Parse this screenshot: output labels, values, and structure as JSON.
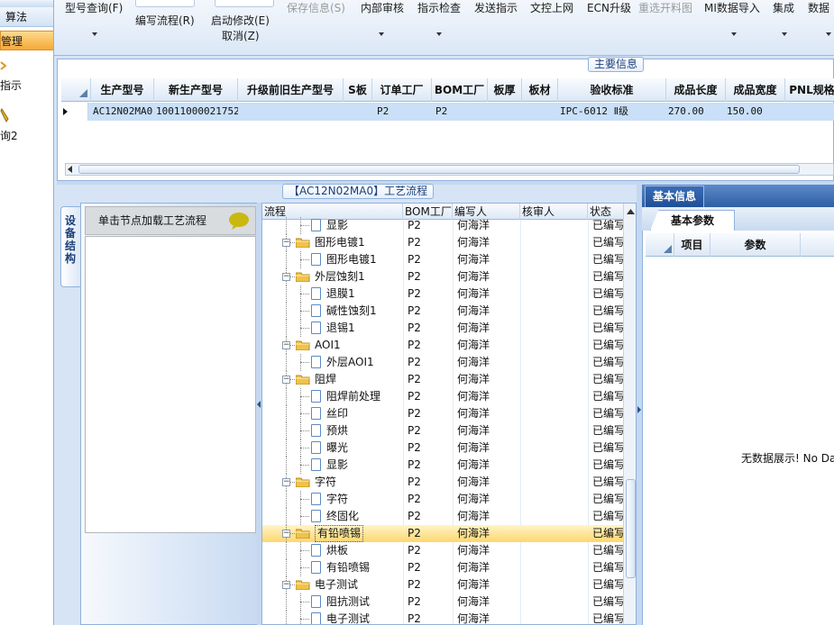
{
  "leftnav": {
    "items": [
      "算法",
      "管理",
      "指示",
      "询2"
    ]
  },
  "toolbar": {
    "items": [
      {
        "label": "型号查询(F)",
        "enabled": true
      },
      {
        "label": "编写流程(R)",
        "enabled": true
      },
      {
        "label": "启动修改(E)",
        "enabled": true
      },
      {
        "label": "取消(Z)",
        "enabled": true
      },
      {
        "label": "保存信息(S)",
        "enabled": false
      },
      {
        "label": "内部审核",
        "enabled": true
      },
      {
        "label": "指示检查",
        "enabled": true
      },
      {
        "label": "发送指示",
        "enabled": true
      },
      {
        "label": "文控上网",
        "enabled": true
      },
      {
        "label": "ECN升级",
        "enabled": true
      },
      {
        "label": "重选开料图",
        "enabled": false
      },
      {
        "label": "MI数据导入",
        "enabled": true
      },
      {
        "label": "集成",
        "enabled": true
      },
      {
        "label": "数据",
        "enabled": true
      }
    ]
  },
  "main_panel": {
    "caption": "主要信息",
    "columns": [
      "生产型号",
      "新生产型号",
      "升级前旧生产型号",
      "S板",
      "订单工厂",
      "BOM工厂",
      "板厚",
      "板材",
      "验收标准",
      "成品长度",
      "成品宽度",
      "PNL规格"
    ],
    "row": {
      "production_model": "AC12N02MA0",
      "new_model": "10011000021752",
      "old_model": "",
      "s_board": "",
      "order_factory": "P2",
      "bom_factory": "P2",
      "thickness": "",
      "material": "",
      "acceptance": "IPC-6012 Ⅱ级",
      "length": "270.00",
      "width": "150.00",
      "pnl": ""
    }
  },
  "process_panel": {
    "caption": "【AC12N02MA0】工艺流程"
  },
  "left_section": {
    "vertical_tab": "设备结构",
    "node_hint": "单击节点加载工艺流程"
  },
  "tree": {
    "columns": [
      "流程",
      "BOM工厂",
      "编写人",
      "核审人",
      "状态"
    ],
    "rows": [
      {
        "name": "显影",
        "level": 2,
        "factory": "P2",
        "writer": "何海洋",
        "reviewer": "",
        "status": "已编写",
        "partial": true
      },
      {
        "name": "图形电镀1",
        "level": 1,
        "factory": "P2",
        "writer": "何海洋",
        "reviewer": "",
        "status": "已编写"
      },
      {
        "name": "图形电镀1",
        "level": 2,
        "factory": "P2",
        "writer": "何海洋",
        "reviewer": "",
        "status": "已编写"
      },
      {
        "name": "外层蚀刻1",
        "level": 1,
        "factory": "P2",
        "writer": "何海洋",
        "reviewer": "",
        "status": "已编写"
      },
      {
        "name": "退膜1",
        "level": 2,
        "factory": "P2",
        "writer": "何海洋",
        "reviewer": "",
        "status": "已编写"
      },
      {
        "name": "碱性蚀刻1",
        "level": 2,
        "factory": "P2",
        "writer": "何海洋",
        "reviewer": "",
        "status": "已编写"
      },
      {
        "name": "退锡1",
        "level": 2,
        "factory": "P2",
        "writer": "何海洋",
        "reviewer": "",
        "status": "已编写"
      },
      {
        "name": "AOI1",
        "level": 1,
        "factory": "P2",
        "writer": "何海洋",
        "reviewer": "",
        "status": "已编写"
      },
      {
        "name": "外层AOI1",
        "level": 2,
        "factory": "P2",
        "writer": "何海洋",
        "reviewer": "",
        "status": "已编写"
      },
      {
        "name": "阻焊",
        "level": 1,
        "factory": "P2",
        "writer": "何海洋",
        "reviewer": "",
        "status": "已编写"
      },
      {
        "name": "阻焊前处理",
        "level": 2,
        "factory": "P2",
        "writer": "何海洋",
        "reviewer": "",
        "status": "已编写"
      },
      {
        "name": "丝印",
        "level": 2,
        "factory": "P2",
        "writer": "何海洋",
        "reviewer": "",
        "status": "已编写"
      },
      {
        "name": "预烘",
        "level": 2,
        "factory": "P2",
        "writer": "何海洋",
        "reviewer": "",
        "status": "已编写"
      },
      {
        "name": "曝光",
        "level": 2,
        "factory": "P2",
        "writer": "何海洋",
        "reviewer": "",
        "status": "已编写"
      },
      {
        "name": "显影",
        "level": 2,
        "factory": "P2",
        "writer": "何海洋",
        "reviewer": "",
        "status": "已编写"
      },
      {
        "name": "字符",
        "level": 1,
        "factory": "P2",
        "writer": "何海洋",
        "reviewer": "",
        "status": "已编写"
      },
      {
        "name": "字符",
        "level": 2,
        "factory": "P2",
        "writer": "何海洋",
        "reviewer": "",
        "status": "已编写"
      },
      {
        "name": "终固化",
        "level": 2,
        "factory": "P2",
        "writer": "何海洋",
        "reviewer": "",
        "status": "已编写"
      },
      {
        "name": "有铅喷锡",
        "level": 1,
        "factory": "P2",
        "writer": "何海洋",
        "reviewer": "",
        "status": "已编写",
        "selected": true
      },
      {
        "name": "烘板",
        "level": 2,
        "factory": "P2",
        "writer": "何海洋",
        "reviewer": "",
        "status": "已编写"
      },
      {
        "name": "有铅喷锡",
        "level": 2,
        "factory": "P2",
        "writer": "何海洋",
        "reviewer": "",
        "status": "已编写"
      },
      {
        "name": "电子测试",
        "level": 1,
        "factory": "P2",
        "writer": "何海洋",
        "reviewer": "",
        "status": "已编写"
      },
      {
        "name": "阻抗测试",
        "level": 2,
        "factory": "P2",
        "writer": "何海洋",
        "reviewer": "",
        "status": "已编写"
      },
      {
        "name": "电子测试",
        "level": 2,
        "factory": "P2",
        "writer": "何海洋",
        "reviewer": "",
        "status": "已编写"
      }
    ]
  },
  "right_panel": {
    "tab": "基本信息",
    "subtab": "基本参数",
    "columns": [
      "项目",
      "参数"
    ],
    "empty_text": "无数据展示! No Da"
  },
  "colors": {
    "accent": "#2f5fa4",
    "selected_row": "#c9e0f8",
    "highlight": "#ffd76e",
    "nav_active": "#f5a93a"
  }
}
